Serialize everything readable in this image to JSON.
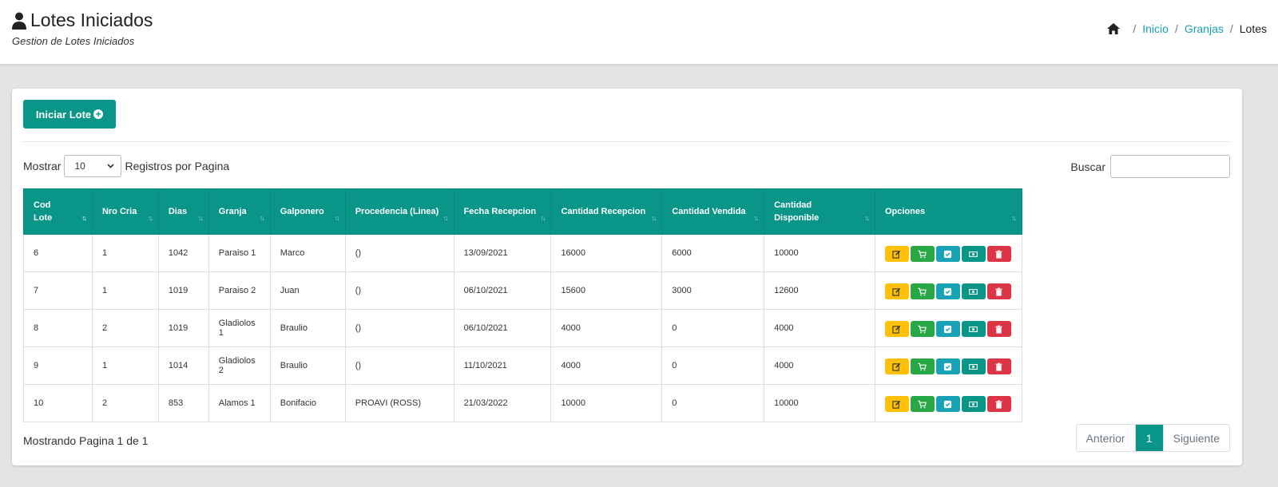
{
  "header": {
    "title": "Lotes Iniciados",
    "subtitle": "Gestion de Lotes Iniciados",
    "breadcrumb": [
      "Inicio",
      "Granjas",
      "Lotes"
    ]
  },
  "toolbar": {
    "start_label": "Iniciar Lote"
  },
  "filters": {
    "show_label": "Mostrar",
    "page_size": "10",
    "per_page_label": "Registros por Pagina",
    "search_label": "Buscar",
    "search_value": ""
  },
  "table": {
    "columns": [
      "Cod Lote",
      "Nro Cria",
      "Dias",
      "Granja",
      "Galponero",
      "Procedencia (Linea)",
      "Fecha Recepcion",
      "Cantidad Recepcion",
      "Cantidad Vendida",
      "Cantidad Disponible",
      "Opciones"
    ],
    "rows": [
      [
        "6",
        "1",
        "1042",
        "Paraiso 1",
        "Marco",
        "()",
        "13/09/2021",
        "16000",
        "6000",
        "10000"
      ],
      [
        "7",
        "1",
        "1019",
        "Paraiso 2",
        "Juan",
        "()",
        "06/10/2021",
        "15600",
        "3000",
        "12600"
      ],
      [
        "8",
        "2",
        "1019",
        "Gladiolos 1",
        "Braulio",
        "()",
        "06/10/2021",
        "4000",
        "0",
        "4000"
      ],
      [
        "9",
        "1",
        "1014",
        "Gladiolos 2",
        "Braulio",
        "()",
        "11/10/2021",
        "4000",
        "0",
        "4000"
      ],
      [
        "10",
        "2",
        "853",
        "Alamos 1",
        "Bonifacio",
        "PROAVI (ROSS)",
        "21/03/2022",
        "10000",
        "0",
        "10000"
      ]
    ]
  },
  "footer": {
    "showing": "Mostrando Pagina 1 de 1",
    "prev_label": "Anterior",
    "current_page": "1",
    "next_label": "Siguiente"
  },
  "colors": {
    "primary": "#099688",
    "edit": "#fec107",
    "cart": "#28a745",
    "check": "#17a2b8",
    "delete": "#dc3545",
    "link": "#17a2b8"
  },
  "icons": {
    "title": "user-icon",
    "breadcrumb": "home-icon",
    "start_button": "plus-circle-icon",
    "row_actions": [
      "edit-icon",
      "cart-icon",
      "check-icon",
      "money-icon",
      "trash-icon"
    ]
  }
}
